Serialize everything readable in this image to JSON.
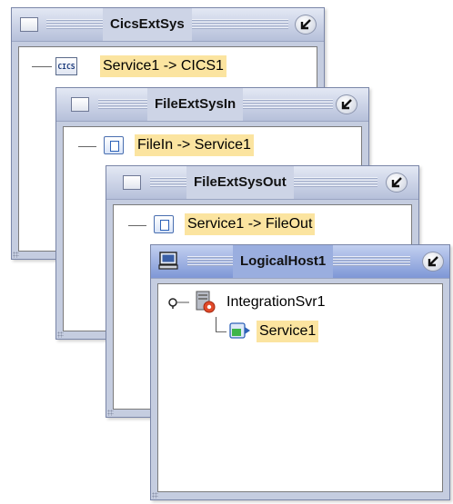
{
  "windows": [
    {
      "title": "CicsExtSys",
      "item": {
        "label": "Service1 -> CICS1",
        "icon": "cics-icon",
        "icon_text": "CICS"
      }
    },
    {
      "title": "FileExtSysIn",
      "item": {
        "label": "FileIn -> Service1",
        "icon": "file-connector-icon"
      }
    },
    {
      "title": "FileExtSysOut",
      "item": {
        "label": "Service1 -> FileOut",
        "icon": "file-connector-icon"
      }
    },
    {
      "title": "LogicalHost1",
      "server": {
        "label": "IntegrationSvr1",
        "icon": "integration-server-icon"
      },
      "service": {
        "label": "Service1",
        "icon": "service-icon"
      }
    }
  ],
  "colors": {
    "highlight": "#fbe4a0",
    "active_titlebar": "#8aa0da"
  }
}
